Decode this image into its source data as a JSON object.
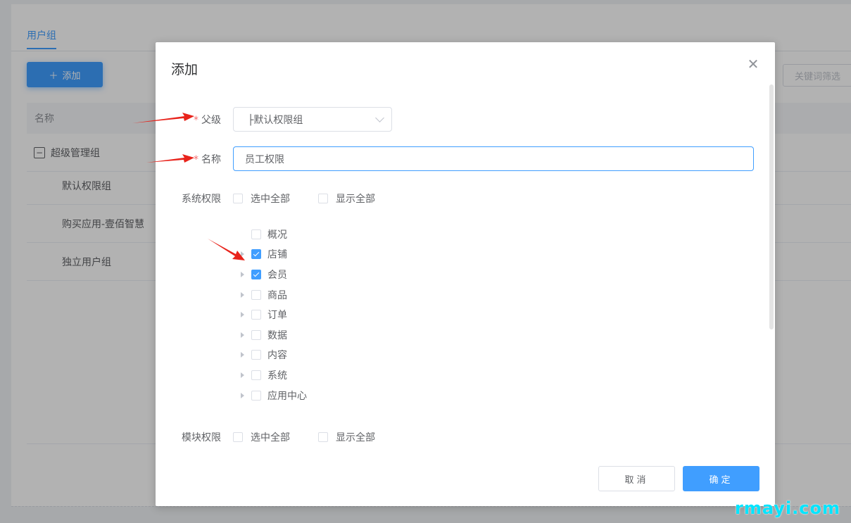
{
  "background": {
    "tab_label": "用户组",
    "add_button": "添加",
    "filter_placeholder": "关键词筛选",
    "table_header": "名称",
    "rows": [
      {
        "label": "超级管理组"
      },
      {
        "label": "默认权限组"
      },
      {
        "label": "购买应用-壹佰智慧"
      },
      {
        "label": "独立用户组"
      }
    ]
  },
  "dialog": {
    "title": "添加",
    "parent_label": "父级",
    "parent_value": "├默认权限组",
    "name_label": "名称",
    "name_value": "员工权限",
    "system_label": "系统权限",
    "module_label": "模块权限",
    "select_all": "选中全部",
    "show_all": "显示全部",
    "tree": [
      {
        "label": "概况",
        "checked": false,
        "expandable": false
      },
      {
        "label": "店铺",
        "checked": true,
        "expandable": true
      },
      {
        "label": "会员",
        "checked": true,
        "expandable": true
      },
      {
        "label": "商品",
        "checked": false,
        "expandable": true
      },
      {
        "label": "订单",
        "checked": false,
        "expandable": true
      },
      {
        "label": "数据",
        "checked": false,
        "expandable": true
      },
      {
        "label": "内容",
        "checked": false,
        "expandable": true
      },
      {
        "label": "系统",
        "checked": false,
        "expandable": true
      },
      {
        "label": "应用中心",
        "checked": false,
        "expandable": true
      }
    ],
    "cancel": "取消",
    "confirm": "确定"
  },
  "watermark": "rmayi.com",
  "colors": {
    "primary": "#409eff",
    "required": "#f56c6c",
    "annotation_arrow": "#e8231b"
  }
}
